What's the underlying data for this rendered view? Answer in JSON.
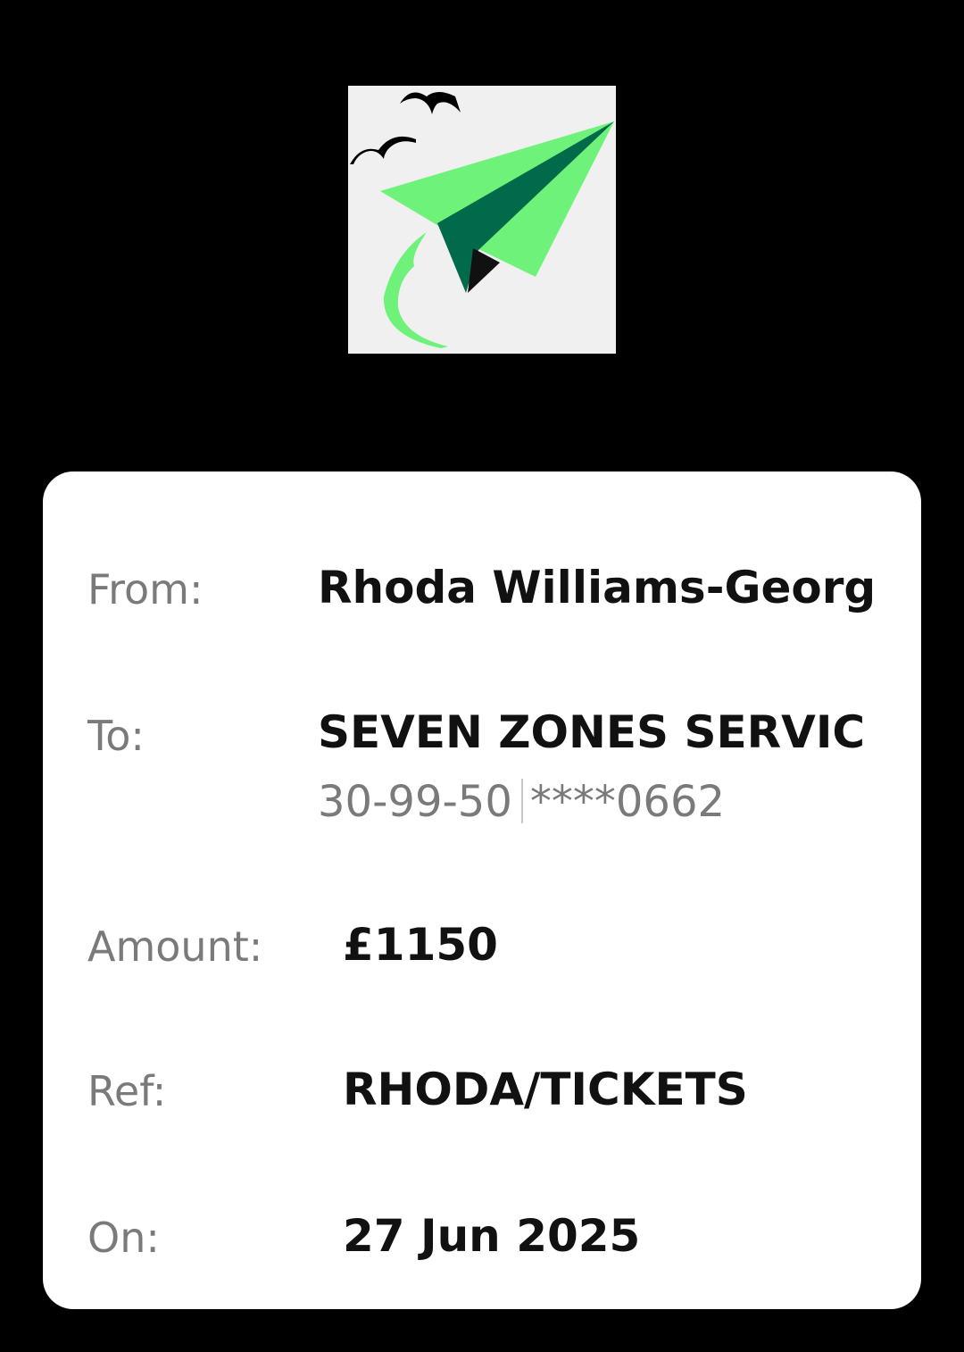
{
  "logo": {
    "icon": "paper-plane-birds-logo-icon",
    "colors": {
      "background": "#f0f0f0",
      "plane_light": "#6ef27a",
      "plane_dark": "#006a4a",
      "tip": "#111111",
      "birds": "#000000"
    }
  },
  "card": {
    "from": {
      "label": "From:",
      "value": "Rhoda Williams-George"
    },
    "to": {
      "label": "To:",
      "value": "SEVEN ZONES SERVIC",
      "sort_code": "30-99-50",
      "account_masked": "****0662"
    },
    "amount": {
      "label": "Amount:",
      "value": "£1150"
    },
    "ref": {
      "label": "Ref:",
      "value": "RHODA/TICKETS"
    },
    "on": {
      "label": "On:",
      "value": "27 Jun 2025"
    }
  },
  "colors": {
    "page_background": "#000000",
    "card_background": "#ffffff",
    "label_text": "#7a7a7a",
    "value_text": "#111111"
  }
}
